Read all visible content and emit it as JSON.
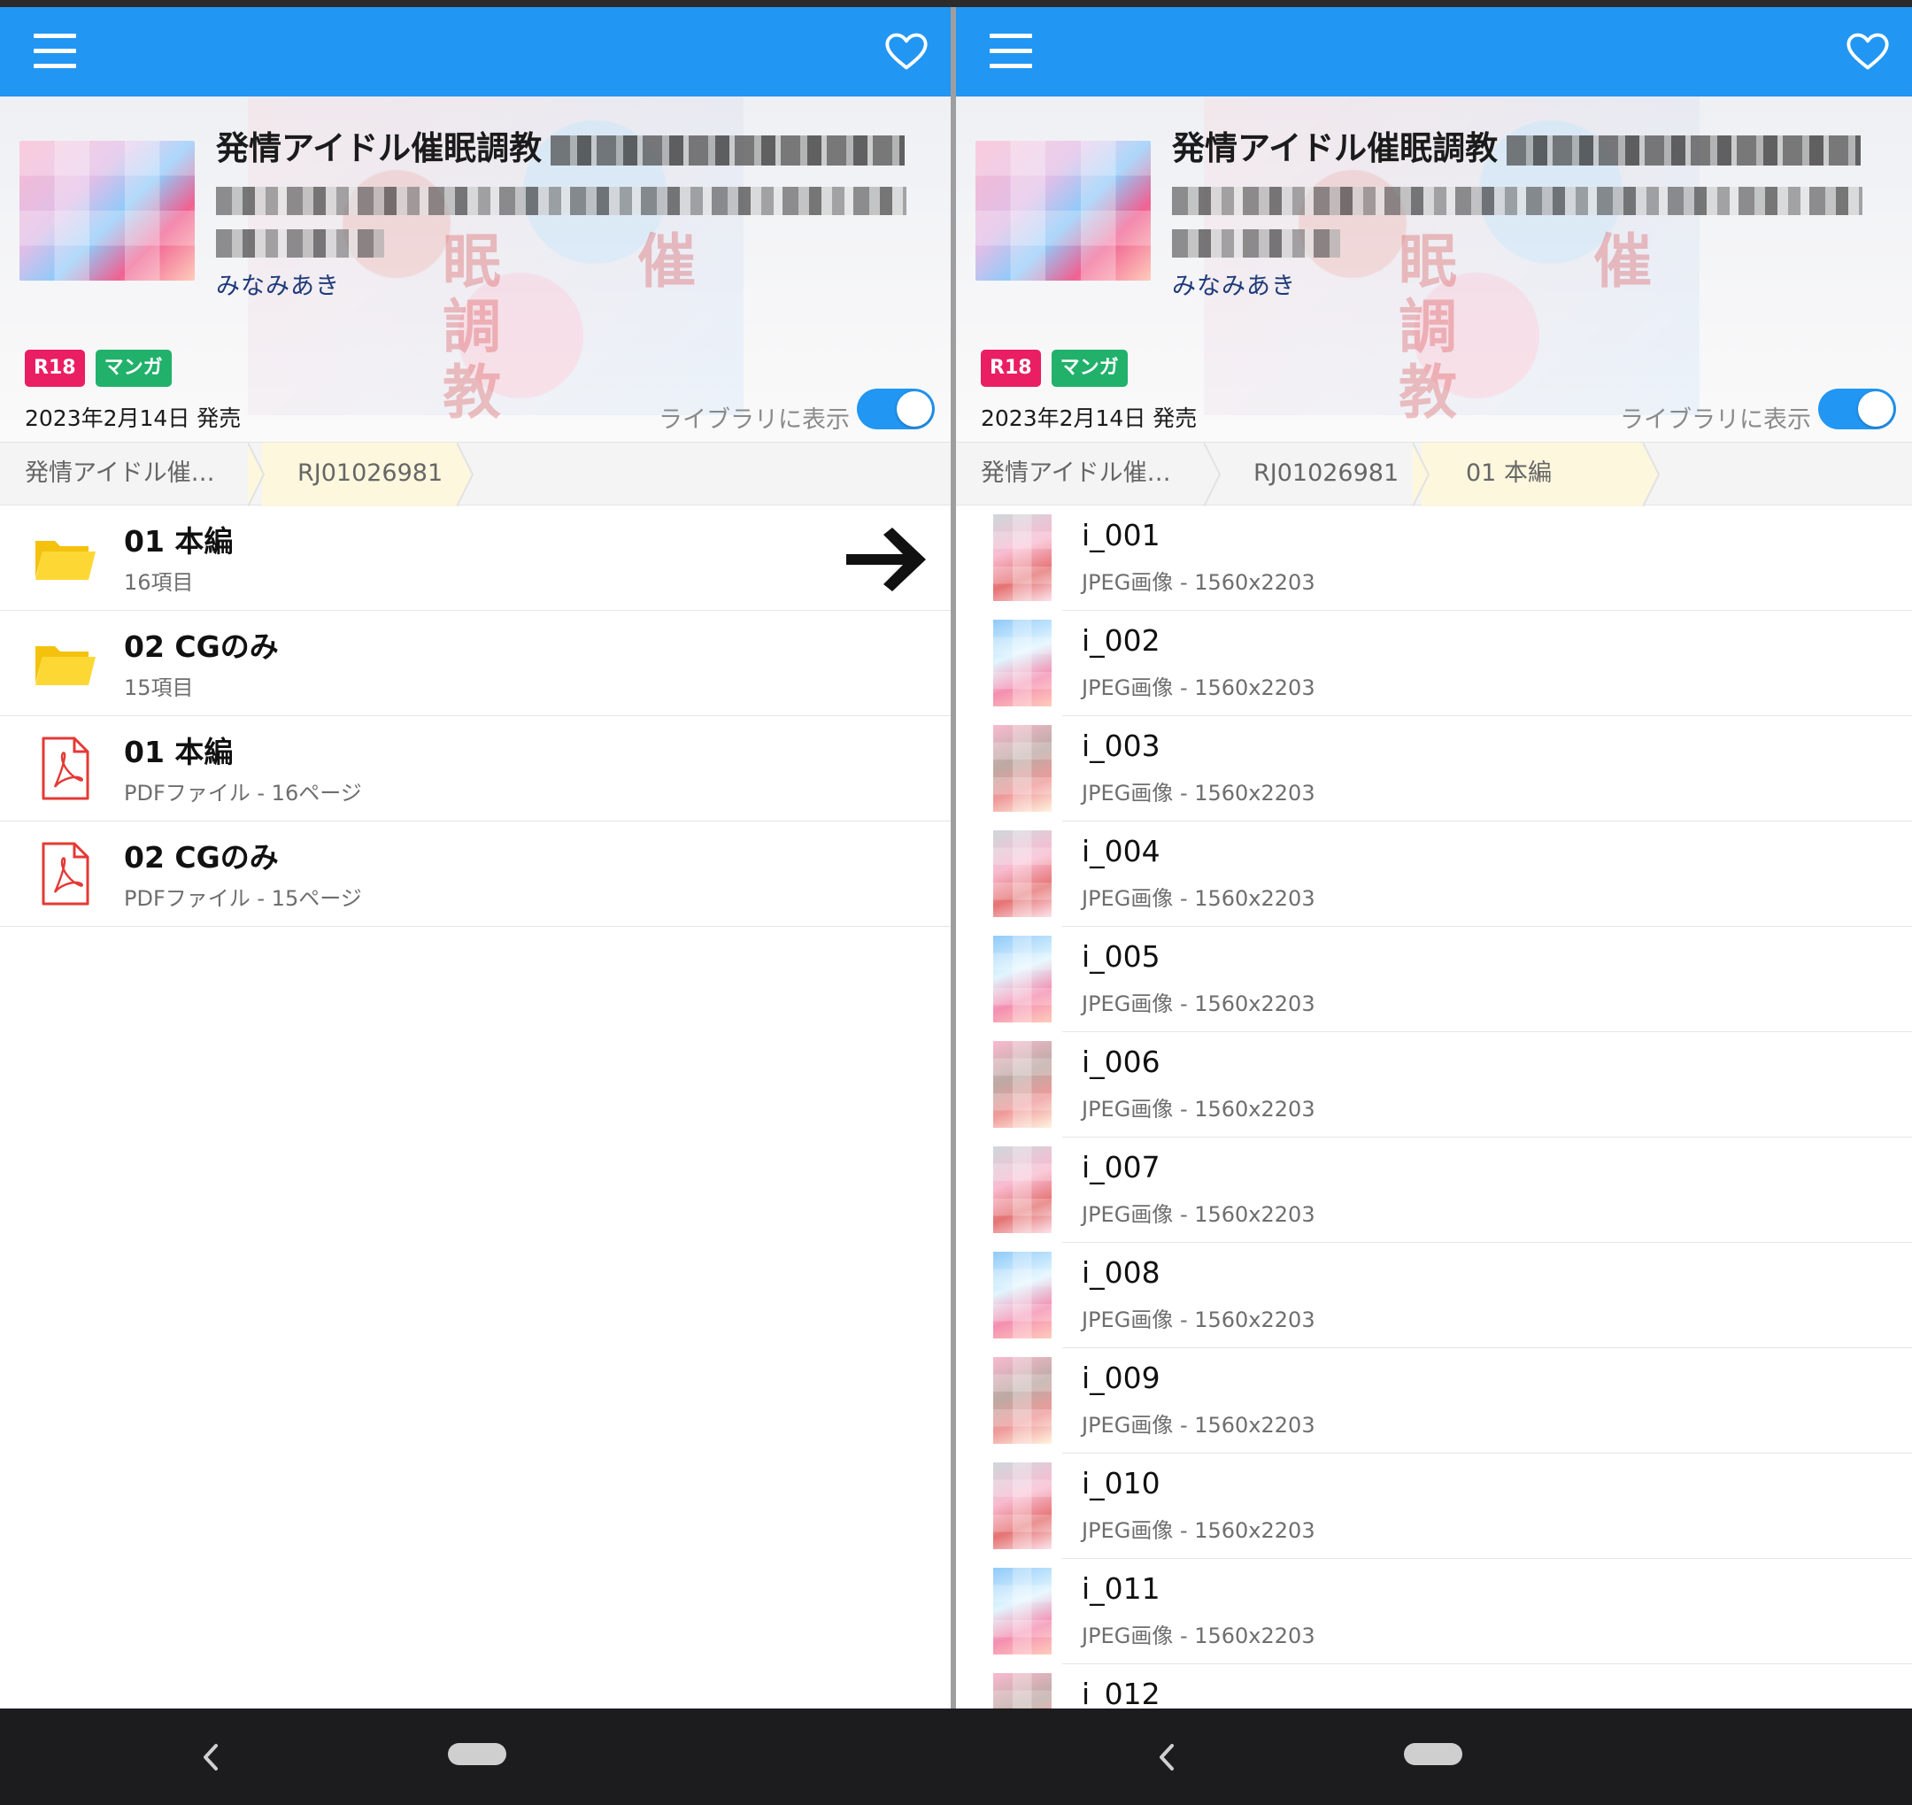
{
  "left": {
    "header": {
      "title": "発情アイドル催眠調教",
      "author": "みなみあき",
      "badges": [
        "R18",
        "マンガ"
      ],
      "release": "2023年2月14日 発売",
      "library_label": "ライブラリに表示",
      "library_on": true,
      "bg_kanji_a": "眠調教",
      "bg_kanji_b": "催"
    },
    "breadcrumbs": [
      "発情アイドル催…",
      "RJ01026981"
    ],
    "items": [
      {
        "type": "folder",
        "name": "01 本編",
        "sub": "16項目"
      },
      {
        "type": "folder",
        "name": "02 CGのみ",
        "sub": "15項目"
      },
      {
        "type": "pdf",
        "name": "01 本編",
        "sub": "PDFファイル - 16ページ"
      },
      {
        "type": "pdf",
        "name": "02 CGのみ",
        "sub": "PDFファイル - 15ページ"
      }
    ]
  },
  "right": {
    "header": {
      "title": "発情アイドル催眠調教",
      "author": "みなみあき",
      "badges": [
        "R18",
        "マンガ"
      ],
      "release": "2023年2月14日 発売",
      "library_label": "ライブラリに表示",
      "library_on": true,
      "bg_kanji_a": "眠調教",
      "bg_kanji_b": "催"
    },
    "breadcrumbs": [
      "発情アイドル催…",
      "RJ01026981",
      "01 本編"
    ],
    "files": [
      {
        "name": "i_001",
        "sub": "JPEG画像 - 1560x2203"
      },
      {
        "name": "i_002",
        "sub": "JPEG画像 - 1560x2203"
      },
      {
        "name": "i_003",
        "sub": "JPEG画像 - 1560x2203"
      },
      {
        "name": "i_004",
        "sub": "JPEG画像 - 1560x2203"
      },
      {
        "name": "i_005",
        "sub": "JPEG画像 - 1560x2203"
      },
      {
        "name": "i_006",
        "sub": "JPEG画像 - 1560x2203"
      },
      {
        "name": "i_007",
        "sub": "JPEG画像 - 1560x2203"
      },
      {
        "name": "i_008",
        "sub": "JPEG画像 - 1560x2203"
      },
      {
        "name": "i_009",
        "sub": "JPEG画像 - 1560x2203"
      },
      {
        "name": "i_010",
        "sub": "JPEG画像 - 1560x2203"
      },
      {
        "name": "i_011",
        "sub": "JPEG画像 - 1560x2203"
      },
      {
        "name": "i_012",
        "sub": ""
      }
    ]
  },
  "colors": {
    "appbar": "#2196f3",
    "r18": "#e91e63",
    "manga": "#21b16b",
    "folder": "#fdd835",
    "pdf": "#e53935",
    "breadcrumb_active": "#fdf7de"
  },
  "icons": {
    "menu": "hamburger-icon",
    "favorite": "heart-icon",
    "folder": "folder-icon",
    "pdf": "pdf-icon",
    "arrow": "arrow-right-icon",
    "back": "nav-back-icon",
    "home": "nav-home-pill"
  }
}
